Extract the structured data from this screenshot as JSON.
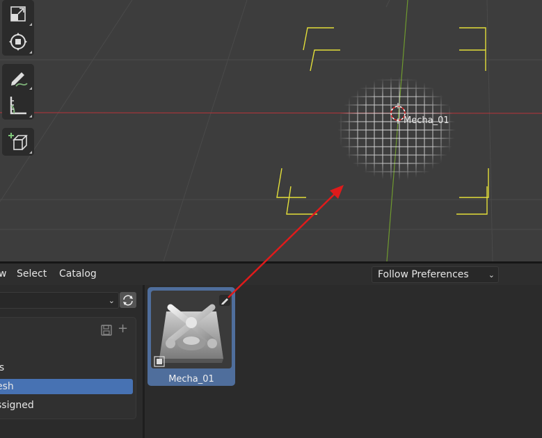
{
  "viewport": {
    "object_label": "Mecha_01",
    "tools": [
      {
        "icon": "scale-icon"
      },
      {
        "icon": "transform-icon"
      },
      {
        "icon": "annotate-icon"
      },
      {
        "icon": "measure-icon"
      },
      {
        "icon": "add-cube-icon"
      }
    ],
    "colors": {
      "x_axis": "#b8343a",
      "y_axis": "#6f9a2f",
      "bounds": "#e3df3a",
      "annotation_arrow": "#e01b1b"
    }
  },
  "asset_browser": {
    "menu": {
      "view": "w",
      "select": "Select",
      "catalog": "Catalog"
    },
    "import_method": "Follow Preferences",
    "catalog_tree": {
      "items": [
        {
          "label": "ls",
          "active": false
        },
        {
          "label": "esh",
          "active": true
        },
        {
          "label": "ssigned",
          "active": false
        }
      ]
    },
    "assets": [
      {
        "name": "Mecha_01",
        "selected": true
      }
    ]
  }
}
